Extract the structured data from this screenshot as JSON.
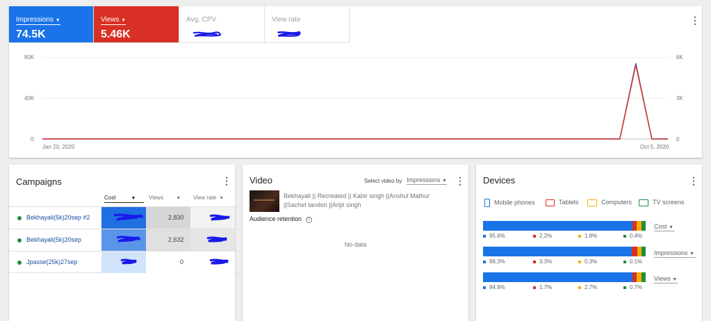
{
  "metrics": {
    "impressions": {
      "label": "Impressions",
      "value": "74.5K"
    },
    "views": {
      "label": "Views",
      "value": "5.46K"
    },
    "avg_cpv": {
      "label": "Avg. CPV"
    },
    "view_rate": {
      "label": "View rate"
    }
  },
  "chart_data": {
    "type": "line",
    "x_labels": [
      "Jan 20, 2020",
      "Oct 5, 2020"
    ],
    "y_left": {
      "ticks": [
        "0",
        "40K",
        "80K"
      ],
      "ylim": [
        0,
        80000
      ]
    },
    "y_right": {
      "ticks": [
        "0",
        "3K",
        "6K"
      ],
      "ylim": [
        0,
        6000
      ]
    },
    "series": [
      {
        "color": "#1a73e8",
        "axis": "left",
        "values": [
          0,
          0,
          0,
          0,
          0,
          0,
          0,
          0,
          0,
          0,
          0,
          0,
          0,
          0,
          0,
          0,
          0,
          0,
          0,
          0,
          0,
          0,
          0,
          0,
          0,
          0,
          0,
          0,
          0,
          0,
          0,
          0,
          0,
          0,
          0,
          0,
          0,
          74500,
          0,
          0
        ]
      },
      {
        "color": "#d93025",
        "axis": "right",
        "values": [
          0,
          0,
          0,
          0,
          0,
          0,
          0,
          0,
          0,
          0,
          0,
          0,
          0,
          0,
          0,
          0,
          0,
          0,
          0,
          0,
          0,
          0,
          0,
          0,
          0,
          0,
          0,
          0,
          0,
          0,
          0,
          0,
          0,
          0,
          0,
          0,
          0,
          5460,
          0,
          0
        ]
      }
    ],
    "colors": {
      "impressions": "#1a73e8",
      "views": "#d93025"
    }
  },
  "campaigns": {
    "title": "Campaigns",
    "columns": [
      "Cost",
      "Views",
      "View rate"
    ],
    "rows": [
      {
        "name": "Bekhayali(5k)20sep #2",
        "views": "2,830"
      },
      {
        "name": "Bekhayali(5k)20sep",
        "views": "2,632"
      },
      {
        "name": "Jpasse(25k)27sep",
        "views": "0"
      }
    ]
  },
  "video": {
    "title": "Video",
    "select_label": "Select video by",
    "select_value": "Impressions",
    "video_title_line1": "Bekhayali || Recreated || Kabir singh ||Anshul Mathur",
    "video_title_line2": "||Sachet tandon ||Arijit singh",
    "retention_label": "Audience retention",
    "no_data": "No data"
  },
  "devices": {
    "title": "Devices",
    "legend": [
      "Mobile phones",
      "Tablets",
      "Computers",
      "TV screens"
    ],
    "colors": [
      "#1a73e8",
      "#d93025",
      "#f9ab00",
      "#1e8e3e"
    ],
    "rows": [
      {
        "metric": "Cost",
        "values": [
          "95.6%",
          "2.2%",
          "1.8%",
          "0.4%"
        ]
      },
      {
        "metric": "Impressions",
        "values": [
          "96.3%",
          "3.3%",
          "0.3%",
          "0.1%"
        ]
      },
      {
        "metric": "Views",
        "values": [
          "94.9%",
          "1.7%",
          "2.7%",
          "0.7%"
        ]
      }
    ]
  }
}
